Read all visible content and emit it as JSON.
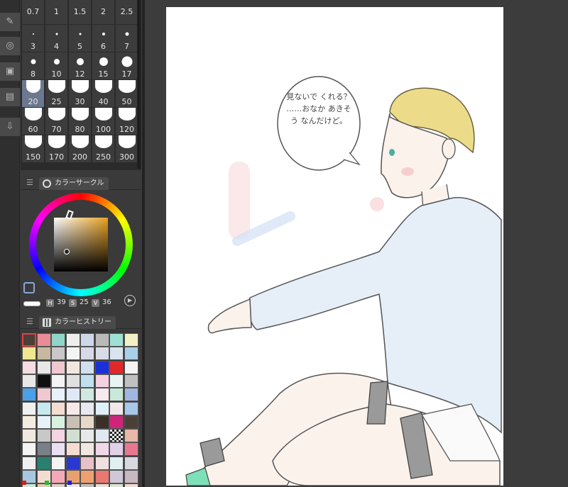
{
  "brush_panel": {
    "sizes": [
      {
        "label": "0.7",
        "dot": 0
      },
      {
        "label": "1",
        "dot": 0
      },
      {
        "label": "1.5",
        "dot": 0
      },
      {
        "label": "2",
        "dot": 0
      },
      {
        "label": "2.5",
        "dot": 0
      },
      {
        "label": "3",
        "dot": 2
      },
      {
        "label": "4",
        "dot": 3
      },
      {
        "label": "5",
        "dot": 3
      },
      {
        "label": "6",
        "dot": 4
      },
      {
        "label": "7",
        "dot": 5
      },
      {
        "label": "8",
        "dot": 7
      },
      {
        "label": "10",
        "dot": 8
      },
      {
        "label": "12",
        "dot": 10
      },
      {
        "label": "15",
        "dot": 12
      },
      {
        "label": "17",
        "dot": 15
      },
      {
        "label": "20",
        "dot": 20
      },
      {
        "label": "25",
        "dot": 24
      },
      {
        "label": "30",
        "dot": 24
      },
      {
        "label": "40",
        "dot": 24
      },
      {
        "label": "50",
        "dot": 24
      },
      {
        "label": "60",
        "dot": 24
      },
      {
        "label": "70",
        "dot": 24
      },
      {
        "label": "80",
        "dot": 24
      },
      {
        "label": "100",
        "dot": 24
      },
      {
        "label": "120",
        "dot": 24
      },
      {
        "label": "150",
        "dot": 24
      },
      {
        "label": "170",
        "dot": 24
      },
      {
        "label": "200",
        "dot": 24
      },
      {
        "label": "250",
        "dot": 24
      },
      {
        "label": "300",
        "dot": 24
      }
    ],
    "selected_size": "20"
  },
  "color_circle": {
    "title": "カラーサークル",
    "h_key": "H",
    "h_value": "39",
    "s_key": "S",
    "s_value": "25",
    "v_key": "V",
    "v_value": "36"
  },
  "color_history": {
    "title": "カラーヒストリー",
    "swatches": [
      "#4a4036",
      "#e88c96",
      "#8fd6c8",
      "#eeeeee",
      "#cfd8e8",
      "#b9b9b9",
      "#9fe0d4",
      "#f2f0c4",
      "#f0e890",
      "#c8b8a0",
      "#c8c8c8",
      "#f4f4f4",
      "#d8d8e8",
      "#d8dce8",
      "#d8e4f0",
      "#a8d0e8",
      "#f4dce0",
      "#e8e8e8",
      "#f0c8d0",
      "#f0e8e0",
      "#d0e0f0",
      "#1c30d8",
      "#e02828",
      "#f4f4f4",
      "#e8e8e8",
      "#101010",
      "#f4f4f4",
      "#e0e0e0",
      "#c0e0f0",
      "#f4d0e0",
      "#e8f4f4",
      "#c0c0c0",
      "#4aa0e8",
      "#f0c8d0",
      "#e8f0f8",
      "#e0e8f8",
      "#d0e8e0",
      "#f8e8f0",
      "#c8e8d8",
      "#a0b8e0",
      "#f0f0f0",
      "#c8e8f0",
      "#f4dcd0",
      "#f8e8e8",
      "#e8e8f0",
      "#e0f0f8",
      "#f0e8e8",
      "#a8c8e8",
      "#f4ece0",
      "#e8f0f8",
      "#d8f0e0",
      "#c8c0b4",
      "#e8d8c8",
      "#3a3028",
      "#d0247a",
      "#4a4036",
      "#f0e8e0",
      "#c8c8c8",
      "#f4d4e0",
      "#d0e0d0",
      "#e8e8e8",
      "#e0e8f0",
      "checker",
      "#e8b8a8",
      "#f4f4f4",
      "#7a8088",
      "#e8e0f0",
      "#f4dcd0",
      "#f0e8e0",
      "#f0d8e8",
      "#e0d0e8",
      "#e87890",
      "#f0f0f0",
      "#2a8070",
      "#f4f4f4",
      "#2838d0",
      "#e8c0c8",
      "#f0e0e0",
      "#e0f0f0",
      "#d8d8e0",
      "#a8c8e0",
      "#f4dcd0",
      "#f4a8b8",
      "#e8a070",
      "#f0a070",
      "#e87870",
      "#d0c8d8",
      "#c8b8c0",
      "#c8e8d8",
      "#e8c8b0",
      "#e0d0c8",
      "#f0e8e0",
      "#c0c0c0",
      "#e8e0d8",
      "#d8e8d0",
      "#f0dcd0"
    ]
  },
  "canvas": {
    "speech_bubble_text": "見ないで くれる？ ……おなか あきそう なんだけど。"
  },
  "colors": {
    "app_bg": "#3a3a3a",
    "panel_bg": "#2b2b2b",
    "selected_cell": "#6b7890",
    "paper": "#ffffff"
  }
}
